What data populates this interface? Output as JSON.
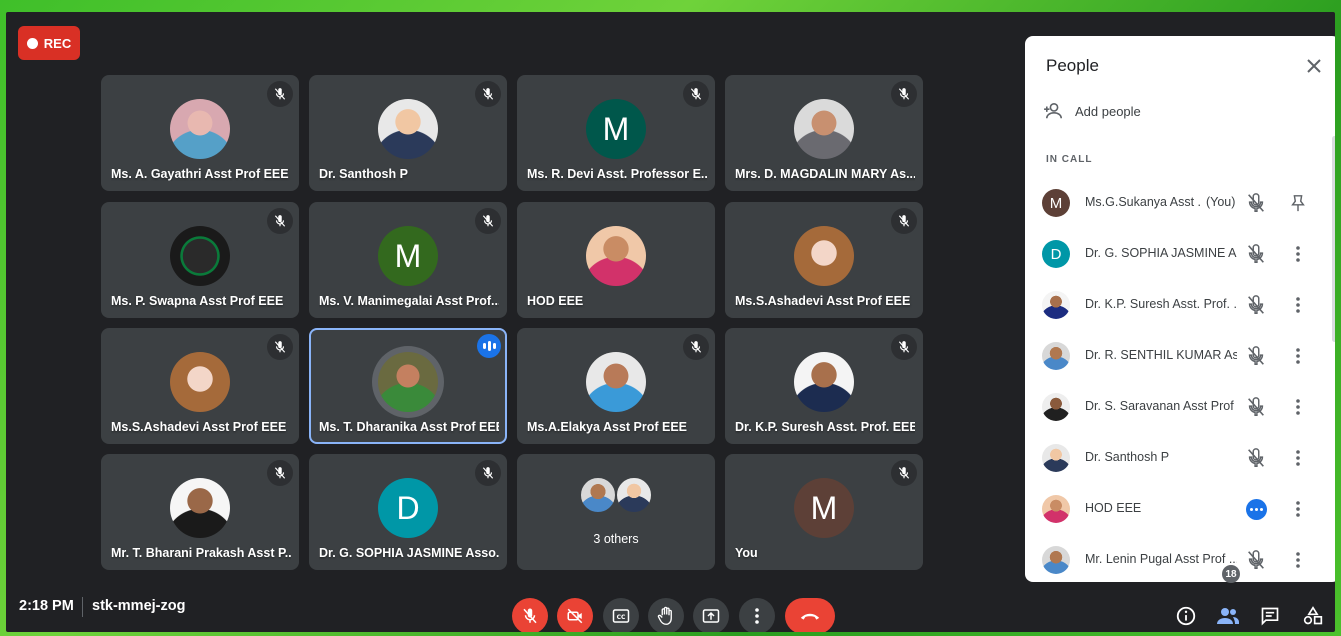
{
  "recording": {
    "label": "REC"
  },
  "tiles": [
    {
      "name": "Ms. A. Gayathri Asst Prof EEE"
    },
    {
      "name": "Dr. Santhosh P"
    },
    {
      "name": "Ms. R. Devi Asst. Professor E...",
      "initial": "M"
    },
    {
      "name": "Mrs. D. MAGDALIN MARY As..."
    },
    {
      "name": "Ms. P. Swapna Asst Prof EEE"
    },
    {
      "name": "Ms. V. Manimegalai Asst Prof...",
      "initial": "M"
    },
    {
      "name": "HOD EEE"
    },
    {
      "name": "Ms.S.Ashadevi Asst Prof EEE"
    },
    {
      "name": "Ms.S.Ashadevi Asst Prof EEE"
    },
    {
      "name": "Ms. T. Dharanika Asst Prof EEE"
    },
    {
      "name": "Ms.A.Elakya Asst Prof EEE"
    },
    {
      "name": "Dr. K.P. Suresh Asst. Prof. EEE"
    },
    {
      "name": "Mr. T. Bharani Prakash Asst P..."
    },
    {
      "name": "Dr. G. SOPHIA JASMINE Asso...",
      "initial": "D"
    },
    {
      "name": "3 others"
    },
    {
      "name": "You",
      "initial": "M"
    }
  ],
  "meeting": {
    "time": "2:18 PM",
    "code": "stk-mmej-zog",
    "participant_count": "18"
  },
  "panel": {
    "title": "People",
    "add_people": "Add people",
    "section": "IN CALL",
    "people": [
      {
        "name": "Ms.G.Sukanya Asst ...",
        "suffix": "(You)",
        "initial": "M"
      },
      {
        "name": "Dr. G. SOPHIA JASMINE A...",
        "initial": "D"
      },
      {
        "name": "Dr. K.P. Suresh Asst. Prof. ..."
      },
      {
        "name": "Dr. R. SENTHIL KUMAR As..."
      },
      {
        "name": "Dr. S. Saravanan Asst Prof ..."
      },
      {
        "name": "Dr. Santhosh P"
      },
      {
        "name": "HOD EEE"
      },
      {
        "name": "Mr. Lenin Pugal Asst Prof ..."
      }
    ]
  },
  "colors": {
    "end_call": "#ea4335",
    "speaking": "#1a73e8",
    "background": "#202124"
  }
}
